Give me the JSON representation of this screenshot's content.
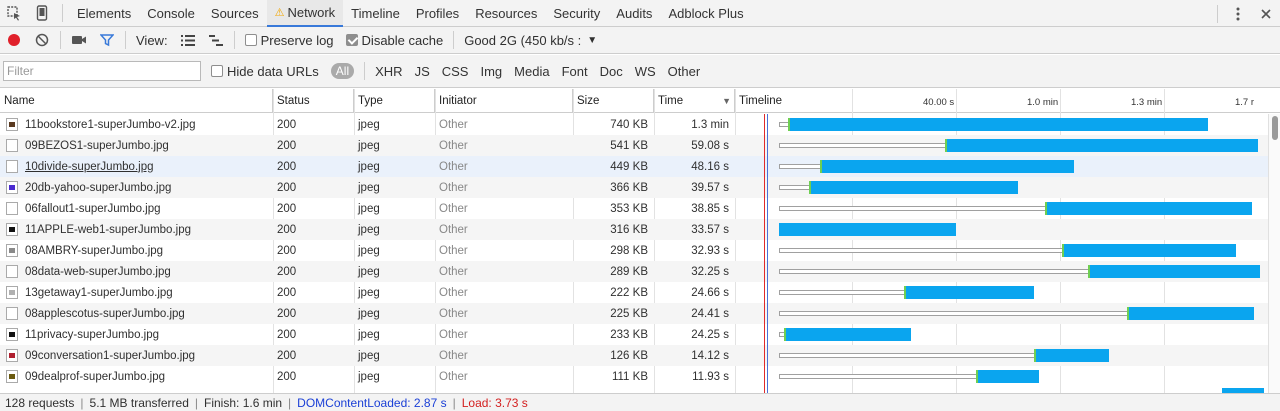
{
  "tabs": [
    {
      "label": "Elements"
    },
    {
      "label": "Console"
    },
    {
      "label": "Sources"
    },
    {
      "label": "Network",
      "warning": true
    },
    {
      "label": "Timeline"
    },
    {
      "label": "Profiles"
    },
    {
      "label": "Resources"
    },
    {
      "label": "Security"
    },
    {
      "label": "Audits"
    },
    {
      "label": "Adblock Plus"
    }
  ],
  "toolbar": {
    "view_label": "View:",
    "preserve_log": "Preserve log",
    "preserve_log_checked": false,
    "disable_cache": "Disable cache",
    "disable_cache_checked": true,
    "throttle": "Good 2G (450 kb/s :"
  },
  "filter": {
    "placeholder": "Filter",
    "hide_data_urls": "Hide data URLs",
    "types": [
      "All",
      "XHR",
      "JS",
      "CSS",
      "Img",
      "Media",
      "Font",
      "Doc",
      "WS",
      "Other"
    ]
  },
  "columns": {
    "name": "Name",
    "status": "Status",
    "type": "Type",
    "initiator": "Initiator",
    "size": "Size",
    "time": "Time",
    "timeline": "Timeline"
  },
  "timeline_ticks": [
    "40.00 s",
    "1.0 min",
    "1.3 min",
    "1.7 r"
  ],
  "rows": [
    {
      "name": "11bookstore1-superJumbo-v2.jpg",
      "status": "200",
      "type": "jpeg",
      "initiator": "Other",
      "size": "740 KB",
      "time": "1.3 min",
      "thumb": "#5a3a20",
      "wait_start": 0.0,
      "dl_start": 0.018,
      "dl_end": 0.885
    },
    {
      "name": "09BEZOS1-superJumbo.jpg",
      "status": "200",
      "type": "jpeg",
      "initiator": "Other",
      "size": "541 KB",
      "time": "59.08 s",
      "thumb": "#ffffff",
      "wait_start": 0.0,
      "dl_start": 0.343,
      "dl_end": 0.988
    },
    {
      "name": "10divide-superJumbo.jpg",
      "status": "200",
      "type": "jpeg",
      "initiator": "Other",
      "size": "449 KB",
      "time": "48.16 s",
      "thumb": "#ffffff",
      "wait_start": 0.0,
      "dl_start": 0.084,
      "dl_end": 0.608
    },
    {
      "name": "20db-yahoo-superJumbo.jpg",
      "status": "200",
      "type": "jpeg",
      "initiator": "Other",
      "size": "366 KB",
      "time": "39.57 s",
      "thumb": "#4a2ad0",
      "wait_start": 0.0,
      "dl_start": 0.061,
      "dl_end": 0.492
    },
    {
      "name": "06fallout1-superJumbo.jpg",
      "status": "200",
      "type": "jpeg",
      "initiator": "Other",
      "size": "353 KB",
      "time": "38.85 s",
      "thumb": "#ffffff",
      "wait_start": 0.0,
      "dl_start": 0.549,
      "dl_end": 0.976
    },
    {
      "name": "11APPLE-web1-superJumbo.jpg",
      "status": "200",
      "type": "jpeg",
      "initiator": "Other",
      "size": "316 KB",
      "time": "33.57 s",
      "thumb": "#111111",
      "wait_start": 0.0,
      "dl_start": 0.0,
      "dl_end": 0.365
    },
    {
      "name": "08AMBRY-superJumbo.jpg",
      "status": "200",
      "type": "jpeg",
      "initiator": "Other",
      "size": "298 KB",
      "time": "32.93 s",
      "thumb": "#8a8a8a",
      "wait_start": 0.0,
      "dl_start": 0.584,
      "dl_end": 0.943
    },
    {
      "name": "08data-web-superJumbo.jpg",
      "status": "200",
      "type": "jpeg",
      "initiator": "Other",
      "size": "289 KB",
      "time": "32.25 s",
      "thumb": "#ffffff",
      "wait_start": 0.0,
      "dl_start": 0.637,
      "dl_end": 0.992
    },
    {
      "name": "13getaway1-superJumbo.jpg",
      "status": "200",
      "type": "jpeg",
      "initiator": "Other",
      "size": "222 KB",
      "time": "24.66 s",
      "thumb": "#b0b0b0",
      "wait_start": 0.0,
      "dl_start": 0.257,
      "dl_end": 0.526
    },
    {
      "name": "08applescotus-superJumbo.jpg",
      "status": "200",
      "type": "jpeg",
      "initiator": "Other",
      "size": "225 KB",
      "time": "24.41 s",
      "thumb": "#ffffff",
      "wait_start": 0.0,
      "dl_start": 0.718,
      "dl_end": 0.98
    },
    {
      "name": "11privacy-superJumbo.jpg",
      "status": "200",
      "type": "jpeg",
      "initiator": "Other",
      "size": "233 KB",
      "time": "24.25 s",
      "thumb": "#111111",
      "wait_start": 0.0,
      "dl_start": 0.01,
      "dl_end": 0.273
    },
    {
      "name": "09conversation1-superJumbo.jpg",
      "status": "200",
      "type": "jpeg",
      "initiator": "Other",
      "size": "126 KB",
      "time": "14.12 s",
      "thumb": "#b02030",
      "wait_start": 0.0,
      "dl_start": 0.525,
      "dl_end": 0.68
    },
    {
      "name": "09dealprof-superJumbo.jpg",
      "status": "200",
      "type": "jpeg",
      "initiator": "Other",
      "size": "111 KB",
      "time": "11.93 s",
      "thumb": "#6a5a10",
      "wait_start": 0.0,
      "dl_start": 0.406,
      "dl_end": 0.537
    }
  ],
  "status": {
    "requests": "128 requests",
    "transferred": "5.1 MB transferred",
    "finish": "Finish: 1.6 min",
    "dom": "DOMContentLoaded: 2.87 s",
    "load": "Load: 3.73 s"
  }
}
